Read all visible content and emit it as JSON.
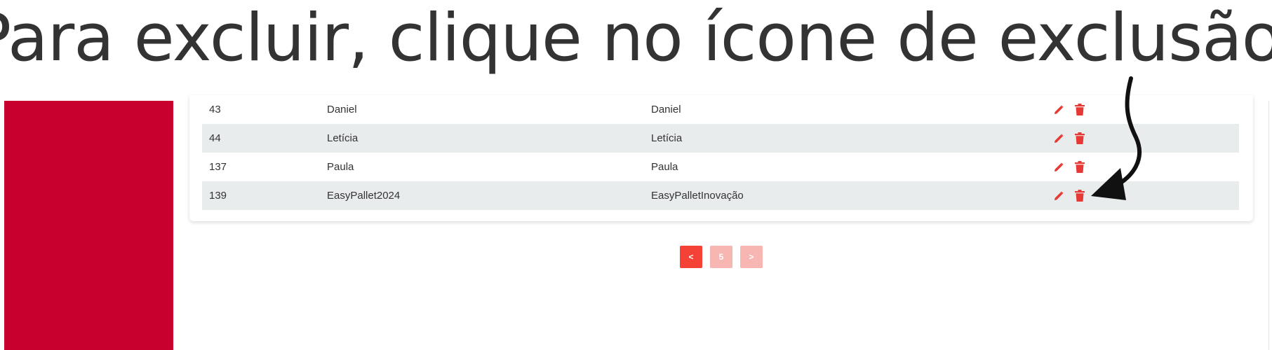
{
  "heading": "Para excluir, clique no ícone de exclusão.",
  "table": {
    "rows": [
      {
        "id": "43",
        "login": "Daniel",
        "name": "Daniel",
        "alt": false
      },
      {
        "id": "44",
        "login": "Letícia",
        "name": "Letícia",
        "alt": true
      },
      {
        "id": "137",
        "login": "Paula",
        "name": "Paula",
        "alt": false
      },
      {
        "id": "139",
        "login": "EasyPallet2024",
        "name": "EasyPalletInovação",
        "alt": true
      }
    ]
  },
  "pagination": {
    "prev_label": "<",
    "current_label": "5",
    "next_label": ">"
  },
  "icons": {
    "edit": "pencil-icon",
    "delete": "trash-icon",
    "annotation": "curved-arrow-icon"
  },
  "colors": {
    "sidebar": "#c8002d",
    "accent": "#f44336",
    "accent_muted": "#f8b6b2",
    "row_alt": "#e9eced",
    "action_icon": "#e53935"
  }
}
